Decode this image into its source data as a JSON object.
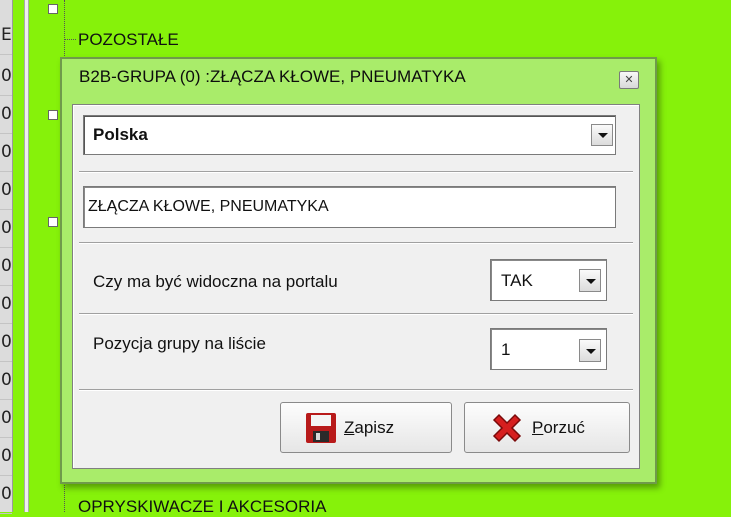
{
  "grid": {
    "top_letter": "E",
    "digits": [
      "0",
      "0",
      "0",
      "0",
      "0",
      "0",
      "0",
      "0",
      "0",
      "0",
      "0",
      "0"
    ]
  },
  "tree": {
    "top_item": "POZOSTAŁE",
    "bottom_item": "OPRYSKIWACZE I AKCESORIA"
  },
  "dialog": {
    "title": "B2B-GRUPA (0) :ZŁĄCZA KŁOWE, PNEUMATYKA",
    "language": {
      "value": "Polska"
    },
    "name": {
      "value": "ZŁĄCZA KŁOWE, PNEUMATYKA"
    },
    "visible": {
      "label": "Czy ma być widoczna  na portalu",
      "value": "TAK"
    },
    "position": {
      "label": "Pozycja grupy na  liście",
      "value": "1"
    },
    "save_button": {
      "mnemonic": "Z",
      "rest": "apisz"
    },
    "cancel_button": {
      "mnemonic": "P",
      "rest": "orzuć"
    },
    "icons": [
      "close-icon",
      "chevron-down-icon",
      "floppy-disk-icon",
      "red-x-icon"
    ],
    "colors": {
      "background": "#86f20a",
      "dialog": "#a9ec6a",
      "panel": "#f0f0f0"
    }
  }
}
